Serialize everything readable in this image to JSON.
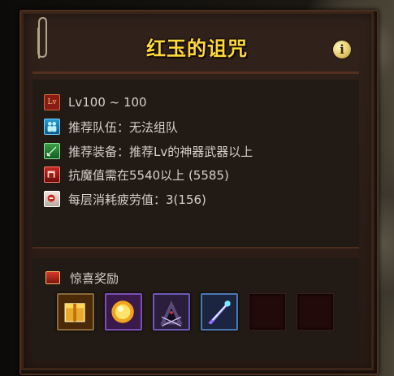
{
  "dungeon": {
    "title": "红玉的诅咒",
    "info_button_label": "i"
  },
  "details": [
    {
      "icon": "level-icon",
      "icon_text": "Lv",
      "text": "Lv100 ~ 100"
    },
    {
      "icon": "team-icon",
      "text": "推荐队伍：无法组队"
    },
    {
      "icon": "sword-icon",
      "text": "推荐装备：推荐Lv的神器武器以上"
    },
    {
      "icon": "resist-icon",
      "text": "抗魔值需在5540以上 (5585)"
    },
    {
      "icon": "fatigue-icon",
      "text": "每层消耗疲劳值：3(156)"
    }
  ],
  "rewards": {
    "title": "惊喜奖励",
    "slots": [
      {
        "name": "golden-box-reward",
        "filled": true
      },
      {
        "name": "golden-orb-reward",
        "filled": true
      },
      {
        "name": "dark-hood-reward",
        "filled": true
      },
      {
        "name": "crystal-blade-reward",
        "filled": true
      },
      {
        "name": "empty-slot",
        "filled": false
      },
      {
        "name": "empty-slot",
        "filled": false
      }
    ]
  },
  "colors": {
    "title": "#ffd93a",
    "text": "#d6d0c8",
    "panel": "#221a14",
    "frame": "#2a1b14"
  }
}
